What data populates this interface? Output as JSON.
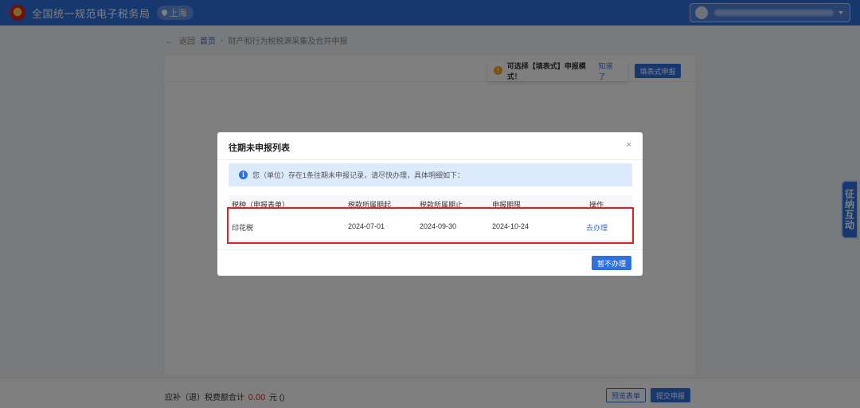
{
  "header": {
    "site_title": "全国统一规范电子税务局",
    "region": "上海"
  },
  "breadcrumb": {
    "back": "返回",
    "home": "首页",
    "separator": "›",
    "current": "财产和行为税税源采集及合并申报"
  },
  "toolbar": {
    "hint_text": "可选择【填表式】申报模式！",
    "hint_link": "知道了",
    "fill_mode_button": "填表式申报"
  },
  "footer": {
    "total_label": "应补（退）税费额合计",
    "total_amount": "0.00",
    "total_unit": "元",
    "total_extra": "()",
    "preview_button": "预览表单",
    "submit_button": "提交申报"
  },
  "side_tab": {
    "label": "征纳互动"
  },
  "modal": {
    "title": "往期未申报列表",
    "close": "×",
    "info_text": "您（单位）存在1条往期未申报记录，请尽快办理，具体明细如下：",
    "columns": [
      "税种（申报表单）",
      "税款所属期起",
      "税款所属期止",
      "申报期限",
      "操作"
    ],
    "rows": [
      {
        "tax_type": "印花税",
        "period_start": "2024-07-01",
        "period_end": "2024-09-30",
        "deadline": "2024-10-24",
        "action": "去办理"
      }
    ],
    "later_button": "暂不办理"
  },
  "colors": {
    "primary": "#2f6fde",
    "highlight_border": "#e02020",
    "info_bg": "#dceafd"
  }
}
